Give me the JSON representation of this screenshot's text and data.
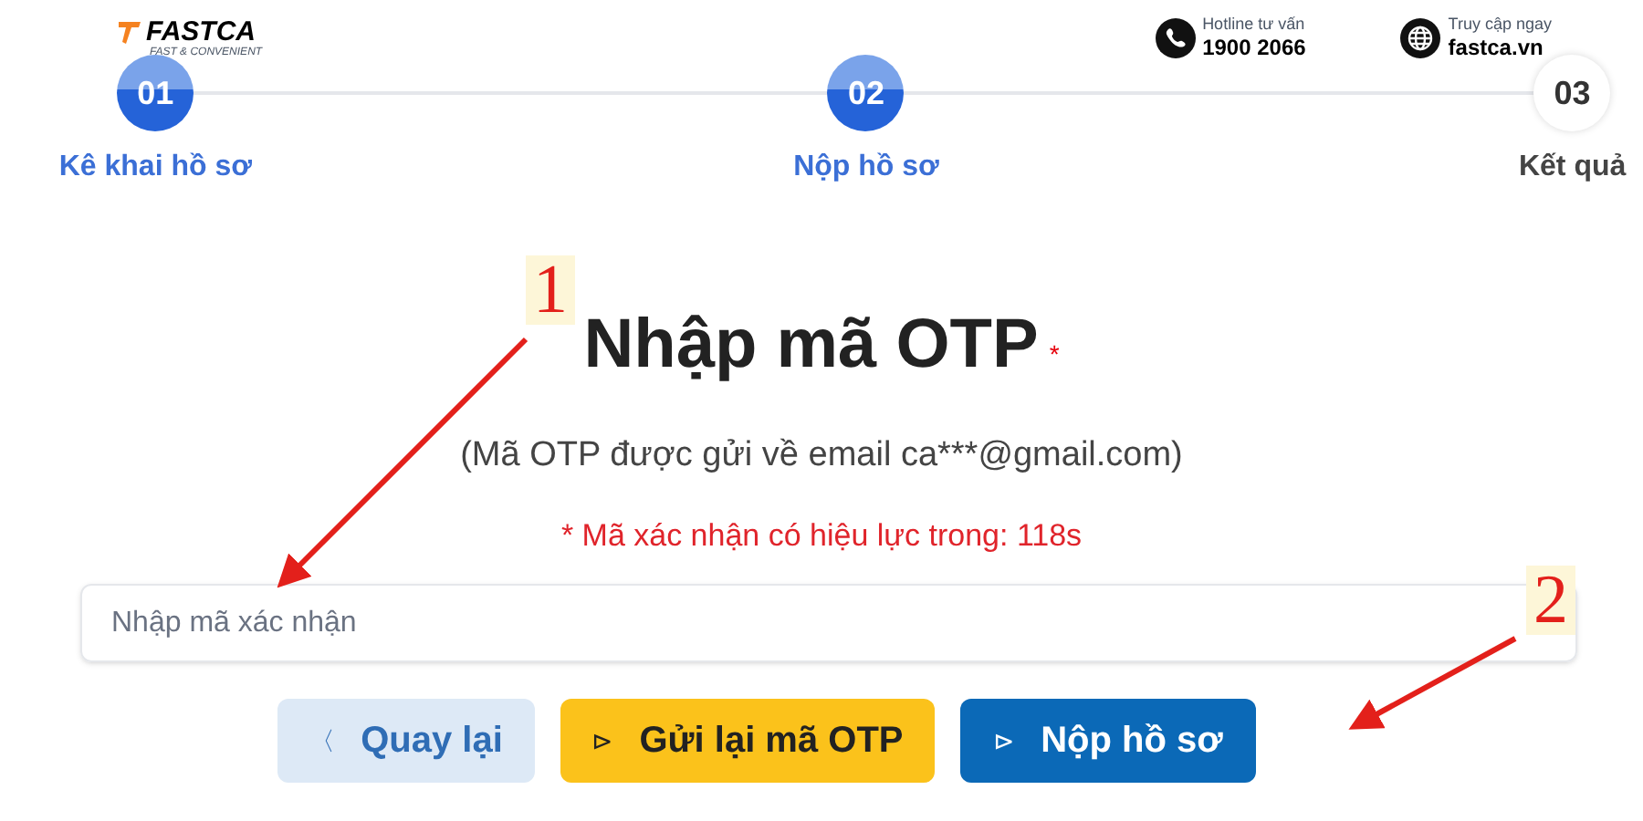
{
  "brand": {
    "name": "FASTCA",
    "tagline": "FAST & CONVENIENT"
  },
  "contacts": [
    {
      "kind": "phone",
      "label": "Hotline tư vấn",
      "value": "1900 2066"
    },
    {
      "kind": "globe",
      "label": "Truy cập ngay",
      "value": "fastca.vn"
    }
  ],
  "steps": [
    {
      "number": "01",
      "label": "Kê khai hồ sơ",
      "done": true
    },
    {
      "number": "02",
      "label": "Nộp hồ sơ",
      "done": true
    },
    {
      "number": "03",
      "label": "Kết quả",
      "done": false
    }
  ],
  "title": "Nhập mã OTP",
  "required_mark": "*",
  "subtitle": "(Mã OTP được gửi về email ca***@gmail.com)",
  "timer_note": "* Mã xác nhận có hiệu lực trong: 118s",
  "otp_field": {
    "placeholder": "Nhập mã xác nhận"
  },
  "buttons": [
    {
      "kind": "back",
      "icon": "〈",
      "label": "Quay lại"
    },
    {
      "kind": "resend",
      "icon": "⊳",
      "label": "Gửi lại mã OTP"
    },
    {
      "kind": "submit",
      "icon": "⊳",
      "label": "Nộp hồ sơ"
    }
  ],
  "annotations": [
    {
      "number": "1"
    },
    {
      "number": "2"
    }
  ]
}
